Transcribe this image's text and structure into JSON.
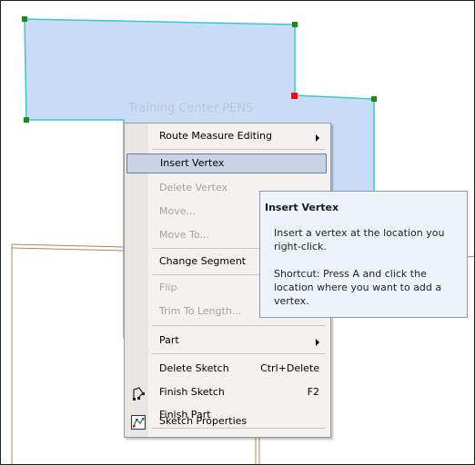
{
  "map": {
    "feature_label": "Training Center PENS",
    "colors": {
      "polygon_fill": "#c9dcf5",
      "polygon_outline": "#3ec6cf",
      "vertex": "#1a8a1a",
      "selected_vertex": "#e0101a",
      "road": "#b5834f"
    }
  },
  "menu": {
    "items": [
      {
        "label": "Route Measure Editing",
        "has_submenu": true,
        "enabled": true
      },
      {
        "label": "Insert Vertex",
        "enabled": true,
        "highlighted": true
      },
      {
        "label": "Delete Vertex",
        "enabled": false
      },
      {
        "label": "Move...",
        "enabled": false
      },
      {
        "label": "Move To...",
        "enabled": false
      },
      {
        "label": "Change Segment",
        "enabled": true
      },
      {
        "label": "Flip",
        "enabled": false
      },
      {
        "label": "Trim To Length...",
        "enabled": false
      },
      {
        "label": "Part",
        "has_submenu": true,
        "enabled": true
      },
      {
        "label": "Delete Sketch",
        "shortcut": "Ctrl+Delete",
        "enabled": true
      },
      {
        "label": "Finish Sketch",
        "shortcut": "F2",
        "enabled": true,
        "icon": "finish-sketch-icon"
      },
      {
        "label": "Finish Part",
        "enabled": true
      },
      {
        "label": "Sketch Properties",
        "enabled": true,
        "icon": "sketch-properties-icon"
      }
    ]
  },
  "tooltip": {
    "title": "Insert Vertex",
    "body": "Insert a vertex at the location you right-click.",
    "shortcut": "Shortcut: Press A and click the location where you want to add a vertex."
  }
}
